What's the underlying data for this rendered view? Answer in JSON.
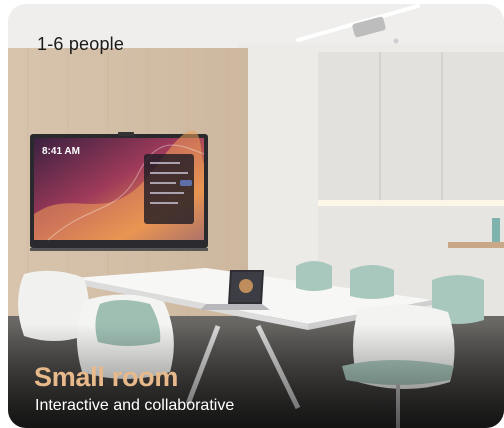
{
  "card": {
    "capacity": "1-6 people",
    "title": "Small room",
    "subtitle": "Interactive and collaborative"
  },
  "display": {
    "clock": "8:41 AM"
  },
  "colors": {
    "title_accent": "#e8b98a",
    "subtitle": "#ffffff",
    "capacity_text": "#1b1b1b",
    "chair_fabric": "#a9c8bd"
  }
}
